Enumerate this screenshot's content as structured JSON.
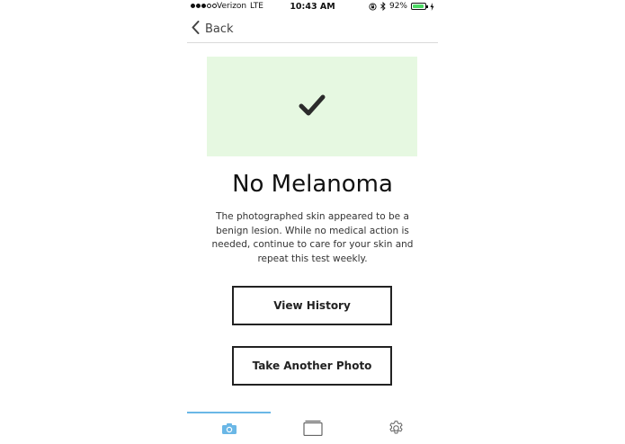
{
  "status_bar": {
    "carrier": "Verizon",
    "network": "LTE",
    "time": "10:43 AM",
    "battery_percent_label": "92%",
    "battery_level": 0.92,
    "signal_bars": 3
  },
  "nav": {
    "back_label": "Back"
  },
  "result": {
    "title": "No Melanoma",
    "message": "The photographed skin appeared to be a benign lesion. While no medical action is needed, continue to care for your skin and repeat this test weekly.",
    "panel_color": "#e6f8e1"
  },
  "actions": {
    "view_history_label": "View History",
    "take_photo_label": "Take Another Photo"
  },
  "tabs": [
    {
      "icon": "camera-icon",
      "active": true
    },
    {
      "icon": "history-icon",
      "active": false
    },
    {
      "icon": "gear-icon",
      "active": false
    }
  ],
  "colors": {
    "accent": "#6ab7e6",
    "battery": "#4cd964"
  }
}
